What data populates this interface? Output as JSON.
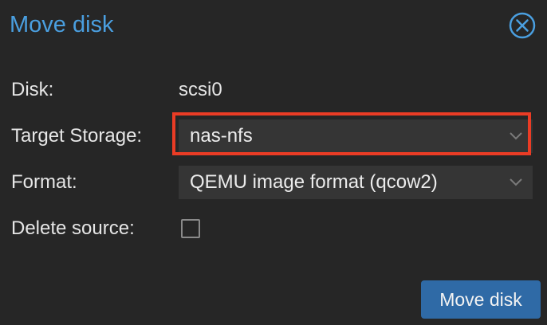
{
  "dialog": {
    "title": "Move disk",
    "close_icon": "close-circle-icon"
  },
  "fields": {
    "disk": {
      "label": "Disk:",
      "value": "scsi0"
    },
    "target_storage": {
      "label": "Target Storage:",
      "value": "nas-nfs"
    },
    "format": {
      "label": "Format:",
      "value": "QEMU image format (qcow2)"
    },
    "delete_source": {
      "label": "Delete source:",
      "checked": false
    }
  },
  "actions": {
    "submit_label": "Move disk"
  },
  "colors": {
    "background": "#262626",
    "title": "#4a9fe0",
    "field_bg": "#353535",
    "highlight": "#ea3c25",
    "primary_button": "#2f6aa6"
  }
}
